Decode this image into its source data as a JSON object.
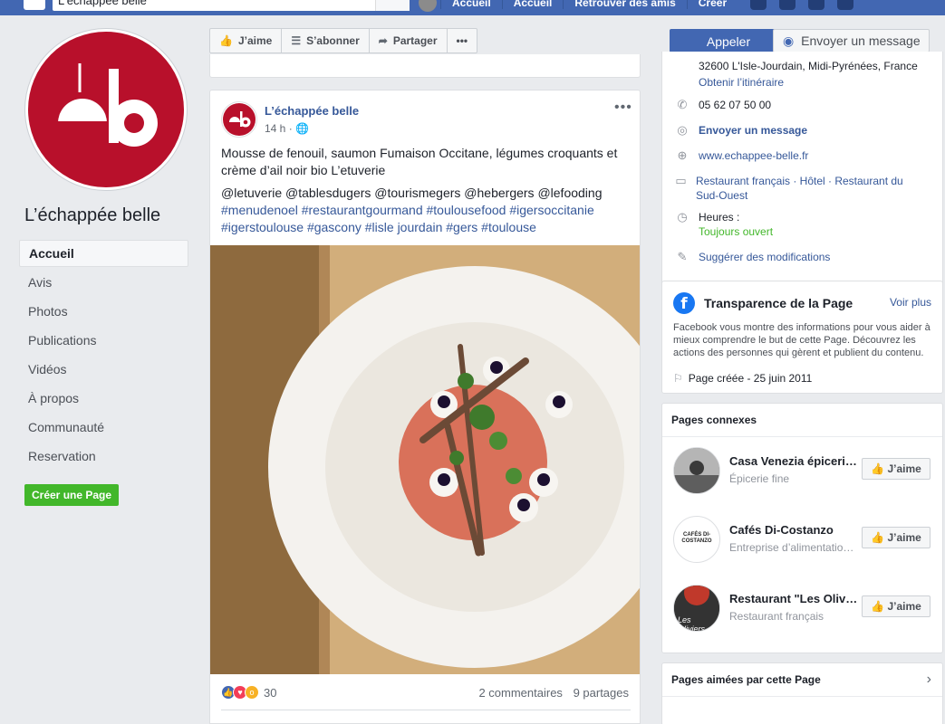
{
  "topbar": {
    "search_value": "L'échappée belle",
    "nav": [
      "Accueil",
      "Accueil",
      "Retrouver des amis",
      "Créer"
    ]
  },
  "page": {
    "name": "L’échappée belle",
    "nav_items": [
      "Accueil",
      "Avis",
      "Photos",
      "Publications",
      "Vidéos",
      "À propos",
      "Communauté",
      "Reservation"
    ],
    "create_page": "Créer une Page"
  },
  "actions": {
    "like": "J’aime",
    "follow": "S’abonner",
    "share": "Partager",
    "more": "•••",
    "call": "Appeler",
    "message": "Envoyer un message"
  },
  "post": {
    "author": "L’échappée belle",
    "time": "14 h",
    "text": "Mousse de fenouil, saumon Fumaison Occitane, légumes croquants et crème d’ail noir bio L’etuverie",
    "mentions": "@letuverie @tablesdugers @tourismegers @hebergers @lefooding",
    "hashtags": "#menudenoel #restaurantgourmand #toulousefood #igersoccitanie #igerstoulouse #gascony #lisle jourdain #gers #toulouse",
    "reactions_count": "30",
    "comments": "2 commentaires",
    "shares": "9 partages"
  },
  "info": {
    "address": "32600 L'Isle-Jourdain, Midi-Pyrénées, France",
    "directions": "Obtenir l’itinéraire",
    "phone": "05 62 07 50 00",
    "send_message": "Envoyer un message",
    "website": "www.echappee-belle.fr",
    "categories": "Restaurant français · Hôtel · Restaurant du Sud-Ouest",
    "hours_label": "Heures :",
    "hours_status": "Toujours ouvert",
    "suggest": "Suggérer des modifications"
  },
  "transparency": {
    "title": "Transparence de la Page",
    "see_more": "Voir plus",
    "text": "Facebook vous montre des informations pour vous aider à mieux comprendre le but de cette Page. Découvrez les actions des personnes qui gèrent et publient du contenu.",
    "created": "Page créée - 25 juin 2011"
  },
  "related": {
    "title": "Pages connexes",
    "like_label": "J’aime",
    "pages": [
      {
        "name": "Casa Venezia épicerie fine",
        "category": "Épicerie fine"
      },
      {
        "name": "Cafés Di-Costanzo",
        "category": "Entreprise d’alimentation et boissons"
      },
      {
        "name": "Restaurant \"Les Oliviers\"",
        "category": "Restaurant français"
      }
    ],
    "thumb_text": [
      "",
      "CAFÉS DI-COSTANZO",
      "Les Oliviers"
    ]
  },
  "liked": {
    "title": "Pages aimées par cette Page"
  },
  "colors": {
    "brand_red": "#b8102b",
    "fb_blue": "#4267b2",
    "link": "#365899",
    "green": "#42b72a"
  }
}
